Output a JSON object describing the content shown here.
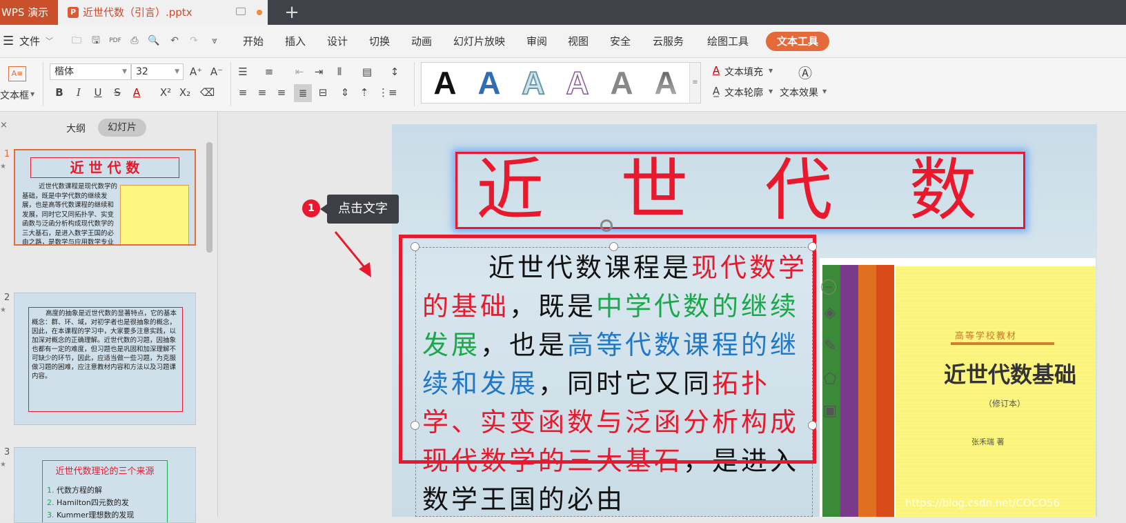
{
  "tabs": {
    "app": "WPS 演示",
    "document": "近世代数（引言）.pptx",
    "new_tab": "+"
  },
  "menu": {
    "file": "文件",
    "items": [
      "开始",
      "插入",
      "设计",
      "切换",
      "动画",
      "幻灯片放映",
      "审阅",
      "视图",
      "安全",
      "云服务",
      "绘图工具"
    ],
    "active": "文本工具"
  },
  "ribbon": {
    "textbox": "文本框",
    "font_name": "楷体",
    "font_size": "32",
    "text_fill": "文本填充",
    "text_outline": "文本轮廓",
    "text_effect": "文本效果",
    "style_letter": "A"
  },
  "panel": {
    "tab_outline": "大纲",
    "tab_slides": "幻灯片",
    "slide_numbers": [
      "1",
      "2",
      "3"
    ],
    "thumb1": {
      "title": "近 世 代 数",
      "body": "近世代数课程是现代数学的基础，既是中学代数的继续发展，也是高等代数课程的继续和发展，同时它又同拓扑学、实变函数与泛函分析构成现代数学的三大基石，是进入数学王国的必由之路，是数学与应用数学专业学生必修的重要基础课。"
    },
    "thumb2": {
      "body": "高度的抽象是近世代数的显著特点，它的基本概念：群、环、域，对初学者也是很抽象的概念，因此，在本课程的学习中，大家要多注意实践，以加深对概念的正确理解。近世代数的习题，因抽象也都有一定的难度，但习题也是巩固和加深理解不可缺少的环节，因此，应适当做一些习题，为克服做习题的困难，应注意教材内容和方法以及习题课内容。"
    },
    "thumb3": {
      "title": "近世代数理论的三个来源",
      "items": [
        "代数方程的解",
        "Hamilton四元数的发",
        "Kummer理想数的发现"
      ]
    }
  },
  "slide": {
    "title": "近 世 代 数",
    "body": [
      {
        "text": "近世代数课程是",
        "color": "#111111"
      },
      {
        "text": "现代数学的基础",
        "color": "#e8192c"
      },
      {
        "text": "，既是",
        "color": "#111111"
      },
      {
        "text": "中学代数的继续发展",
        "color": "#1aa84a"
      },
      {
        "text": "，也是",
        "color": "#111111"
      },
      {
        "text": "高等代数课程的继续和发展",
        "color": "#1f78c8"
      },
      {
        "text": "，同时它又同",
        "color": "#111111"
      },
      {
        "text": "拓扑学、实变函数与泛函分析构成现代数学的三大基石",
        "color": "#e8192c"
      },
      {
        "text": "，是进入数学王国的必由",
        "color": "#111111"
      }
    ],
    "book": {
      "series": "高等学校教材",
      "title": "近世代数基础",
      "edition": "（修订本）",
      "author": "张禾瑞 著"
    }
  },
  "annotation": {
    "number": "1",
    "label": "点击文字"
  },
  "watermark": "https://blog.csdn.net/COCO56",
  "colors": {
    "accent": "#e56a3a",
    "red": "#e8192c",
    "green": "#1aa84a",
    "blue": "#1f78c8"
  }
}
